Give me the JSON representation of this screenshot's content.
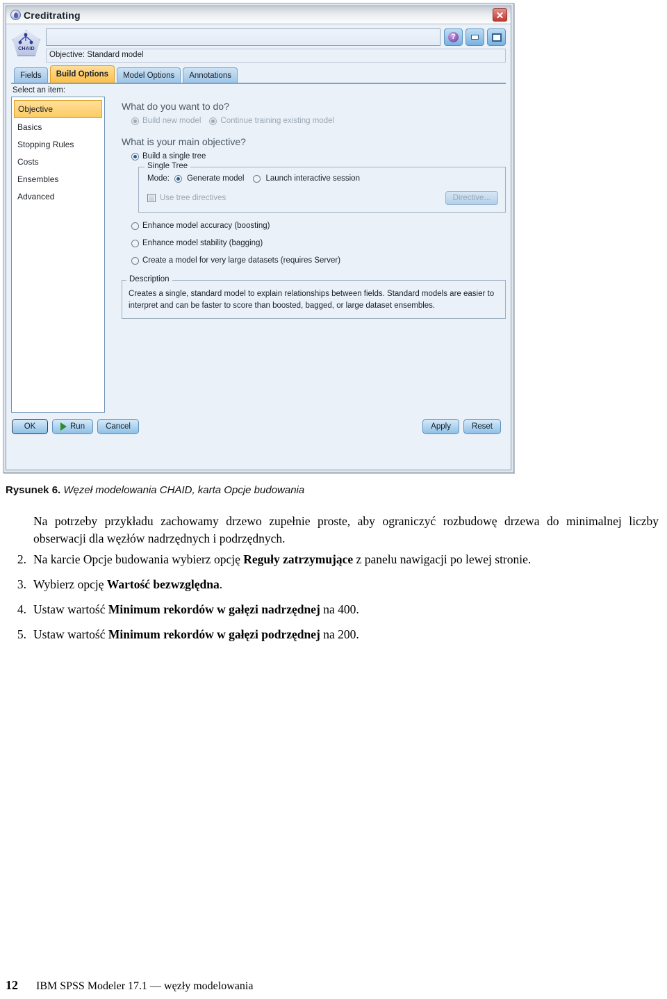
{
  "dialog": {
    "title": "Creditrating",
    "node_icon_label": "CHAID",
    "name_field_value": "",
    "objective_bar": "Objective: Standard model",
    "titlebar_buttons": {
      "close": "✕",
      "help": "?",
      "minimize": "–",
      "maximize": "□"
    },
    "tabs": [
      {
        "label": "Fields",
        "selected": false
      },
      {
        "label": "Build Options",
        "selected": true
      },
      {
        "label": "Model Options",
        "selected": false
      },
      {
        "label": "Annotations",
        "selected": false
      }
    ],
    "sidebar": {
      "label": "Select an item:",
      "items": [
        {
          "label": "Objective",
          "selected": true
        },
        {
          "label": "Basics",
          "selected": false
        },
        {
          "label": "Stopping Rules",
          "selected": false
        },
        {
          "label": "Costs",
          "selected": false
        },
        {
          "label": "Ensembles",
          "selected": false
        },
        {
          "label": "Advanced",
          "selected": false
        }
      ]
    },
    "content": {
      "question1": "What do you want to do?",
      "action_build_new": "Build new model",
      "action_continue": "Continue training existing model",
      "question2": "What is your main objective?",
      "objective_single_tree": "Build a single tree",
      "single_tree_group_title": "Single Tree",
      "mode_label": "Mode:",
      "mode_generate": "Generate model",
      "mode_interactive": "Launch interactive session",
      "use_tree_directives": "Use tree directives",
      "directive_button": "Directive...",
      "objective_boosting": "Enhance model accuracy (boosting)",
      "objective_bagging": "Enhance model stability (bagging)",
      "objective_large": "Create a model for very large datasets (requires Server)",
      "description_group_title": "Description",
      "description_text": "Creates a single, standard model to explain relationships between fields.  Standard models are easier to interpret and can be faster to score than boosted, bagged, or large dataset ensembles."
    },
    "buttons": {
      "ok": "OK",
      "run": "Run",
      "cancel": "Cancel",
      "apply": "Apply",
      "reset": "Reset"
    },
    "colors": {
      "tab_selected": "#fcbf49",
      "nav_selected": "#fccb63",
      "body_bg": "#eaf1f9",
      "close_red": "#c0392f",
      "run_green": "#2e8b2e"
    }
  },
  "document": {
    "figure_label": "Rysunek 6.",
    "figure_caption": "Węzeł modelowania CHAID, karta Opcje budowania",
    "paragraph": "Na potrzeby przykładu zachowamy drzewo zupełnie proste, aby ograniczyć rozbudowę drzewa do minimalnej liczby obserwacji dla węzłów nadrzędnych i podrzędnych.",
    "steps": [
      {
        "num": "2.",
        "pre": "Na karcie Opcje budowania wybierz opcję ",
        "bold": "Reguły zatrzymujące",
        "post": " z panelu nawigacji po lewej stronie."
      },
      {
        "num": "3.",
        "pre": "Wybierz opcję ",
        "bold": "Wartość bezwzględna",
        "post": "."
      },
      {
        "num": "4.",
        "pre": "Ustaw wartość ",
        "bold": "Minimum rekordów w gałęzi nadrzędnej",
        "post": " na 400."
      },
      {
        "num": "5.",
        "pre": "Ustaw wartość ",
        "bold": "Minimum rekordów w gałęzi podrzędnej",
        "post": " na 200."
      }
    ],
    "footer": {
      "page_number": "12",
      "text": "IBM SPSS Modeler 17.1 — węzły modelowania"
    }
  }
}
